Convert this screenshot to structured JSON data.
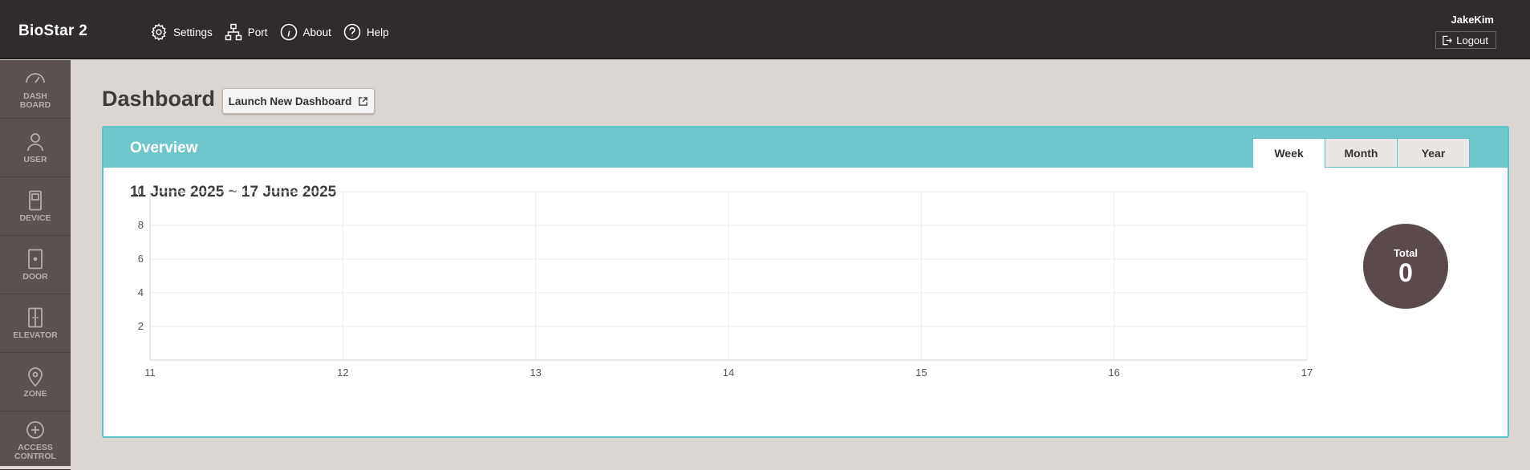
{
  "app": {
    "brand": "BioStar 2"
  },
  "topnav": [
    {
      "label": "Settings",
      "icon": "gear-icon"
    },
    {
      "label": "Port",
      "icon": "network-icon"
    },
    {
      "label": "About",
      "icon": "info-icon"
    },
    {
      "label": "Help",
      "icon": "help-icon"
    }
  ],
  "user": {
    "name": "JakeKim",
    "logout_label": "Logout"
  },
  "sidebar": [
    {
      "label": "DASH\nBOARD",
      "icon": "speedometer-icon"
    },
    {
      "label": "USER",
      "icon": "user-icon"
    },
    {
      "label": "DEVICE",
      "icon": "device-icon"
    },
    {
      "label": "DOOR",
      "icon": "door-icon"
    },
    {
      "label": "ELEVATOR",
      "icon": "elevator-icon"
    },
    {
      "label": "ZONE",
      "icon": "location-pin-icon"
    },
    {
      "label": "ACCESS\nCONTROL",
      "icon": "access-control-icon"
    }
  ],
  "page": {
    "title": "Dashboard",
    "launch_button_label": "Launch New Dashboard"
  },
  "overview": {
    "title": "Overview",
    "tabs": [
      "Week",
      "Month",
      "Year"
    ],
    "active_tab": "Week",
    "date_range": "11 June 2025 ~ 17 June 2025",
    "total_label": "Total",
    "total_value": "0"
  },
  "chart_data": {
    "type": "line",
    "x": [
      11,
      12,
      13,
      14,
      15,
      16,
      17
    ],
    "series": [],
    "y_ticks": [
      2,
      4,
      6,
      8,
      10
    ],
    "ylim": [
      0,
      10
    ],
    "xlim": [
      11,
      17
    ],
    "grid": true,
    "title": "",
    "xlabel": "",
    "ylabel": ""
  },
  "colors": {
    "topbar": "#302c2c",
    "sidebar": "#5b5151",
    "accent": "#6fc6cb",
    "total_circle": "#5b4a4c"
  }
}
